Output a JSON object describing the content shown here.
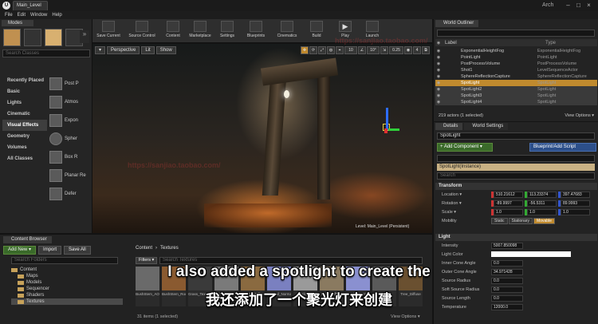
{
  "app": {
    "logo": "U",
    "doc_tab": "Main_Level",
    "user": "Arch"
  },
  "window_buttons": [
    "–",
    "□",
    "×"
  ],
  "menu": [
    "File",
    "Edit",
    "Window",
    "Help"
  ],
  "modes": {
    "tab": "Modes",
    "search_placeholder": "Search Classes",
    "categories": [
      "Recently Placed",
      "Basic",
      "Lights",
      "Cinematic",
      "Visual Effects",
      "Geometry",
      "Volumes",
      "All Classes"
    ],
    "selected_category": "Visual Effects",
    "items": [
      "Post P",
      "Atmos",
      "Expon",
      "Spher",
      "Box R",
      "Planar Re",
      "Defer"
    ]
  },
  "toolbar": [
    "Save Current",
    "Source Control",
    "Content",
    "Marketplace",
    "Settings",
    "Blueprints",
    "Cinematics",
    "Build",
    "Play",
    "Launch"
  ],
  "viewport": {
    "buttons": [
      "▾",
      "Perspective",
      "Lit",
      "Show"
    ],
    "right_buttons": [
      "10",
      "10°",
      "0.25",
      "4"
    ],
    "level_label": "Level:  Main_Level (Persistent)"
  },
  "outliner": {
    "tab": "World Outliner",
    "col_label": "Label",
    "col_type": "Type",
    "rows": [
      {
        "label": "ExponentialHeightFog",
        "type": "ExponentialHeightFog",
        "state": ""
      },
      {
        "label": "PointLight",
        "type": "PointLight",
        "state": ""
      },
      {
        "label": "PostProcessVolume",
        "type": "PostProcessVolume",
        "state": ""
      },
      {
        "label": "Shot1",
        "type": "LevelSequenceActor",
        "state": ""
      },
      {
        "label": "SphereReflectionCapture",
        "type": "SphereReflectionCapture",
        "state": ""
      },
      {
        "label": "SpotLight",
        "type": "SpotLight",
        "state": "sel"
      },
      {
        "label": "SpotLight2",
        "type": "SpotLight",
        "state": "dim"
      },
      {
        "label": "SpotLight3",
        "type": "SpotLight",
        "state": "dim"
      },
      {
        "label": "SpotLight4",
        "type": "SpotLight",
        "state": "dim"
      }
    ],
    "count": "219 actors (1 selected)",
    "view_options": "View Options ▾"
  },
  "details": {
    "tabs": [
      "Details",
      "World Settings"
    ],
    "name": "SpotLight",
    "add_component": "+ Add Component ▾",
    "blueprint_button": "Blueprint/Add Script",
    "instance": "SpotLight(Instance)",
    "search_placeholder": "Search",
    "transform": {
      "section": "Transform",
      "location": {
        "label": "Location ▾",
        "x": "510.21612",
        "y": "113.23374",
        "z": "397.47683"
      },
      "rotation": {
        "label": "Rotation ▾",
        "x": "-89.9997",
        "y": "-56.5311",
        "z": "89.9993"
      },
      "scale": {
        "label": "Scale ▾",
        "x": "1.0",
        "y": "1.0",
        "z": "1.0"
      },
      "mobility": {
        "label": "Mobility",
        "options": [
          "Static",
          "Stationary",
          "Movable"
        ],
        "active": "Movable"
      }
    },
    "light": {
      "section": "Light",
      "props": [
        {
          "label": "Intensity",
          "value": "5007.850098"
        },
        {
          "label": "Light Color",
          "value": ""
        },
        {
          "label": "Inner Cone Angle",
          "value": "0.0"
        },
        {
          "label": "Outer Cone Angle",
          "value": "34.971428"
        },
        {
          "label": "Source Radius",
          "value": "0.0"
        },
        {
          "label": "Soft Source Radius",
          "value": "0.0"
        },
        {
          "label": "Source Length",
          "value": "0.0"
        },
        {
          "label": "Temperature",
          "value": "12000.0"
        }
      ]
    }
  },
  "content_browser": {
    "tab": "Content Browser",
    "add_new": "Add New ▾",
    "import": "Import",
    "save_all": "Save All",
    "path": [
      "Content",
      "Textures"
    ],
    "folder_search": "Search Folders",
    "tree": [
      "Content",
      "Maps",
      "Models",
      "Sequencer",
      "Shaders",
      "Textures"
    ],
    "selected_folder": "Textures",
    "filters": "Filters ▾",
    "search_placeholder": "Search Textures",
    "assets": [
      {
        "name": "BushStem_AO",
        "color": "#6a6a6a"
      },
      {
        "name": "BushStem_RoughAO",
        "color": "#8a5a30"
      },
      {
        "name": "Grass_Texture_Alpha",
        "color": "#3a3a3a"
      },
      {
        "name": "Ground_AO",
        "color": "#7a7a7a"
      },
      {
        "name": "Ground_Diffuse",
        "color": "#8a6a40"
      },
      {
        "name": "Ground_Normal",
        "color": "#7a80c0"
      },
      {
        "name": "Rock_AO",
        "color": "#9a9a9a"
      },
      {
        "name": "Rock_Diffuse",
        "color": "#8a7a60"
      },
      {
        "name": "Rock_Normal",
        "color": "#8a90d0"
      },
      {
        "name": "Tree_AO",
        "color": "#5a5a5a"
      },
      {
        "name": "Tree_Diffuse",
        "color": "#6a5030"
      }
    ],
    "count": "31 items (1 selected)",
    "view_options": "View Options ▾"
  },
  "watermark": [
    "https://sanjiao.taobao.com/",
    "https://sanjiao.taobao.com/"
  ],
  "subtitles": {
    "en": "I also added a spotlight to create the",
    "zh": "我还添加了一个聚光灯来创建"
  },
  "colors": {
    "selection": "#c08a2e",
    "green_button": "#3a6a2a",
    "blue_button": "#2c4f8a"
  }
}
